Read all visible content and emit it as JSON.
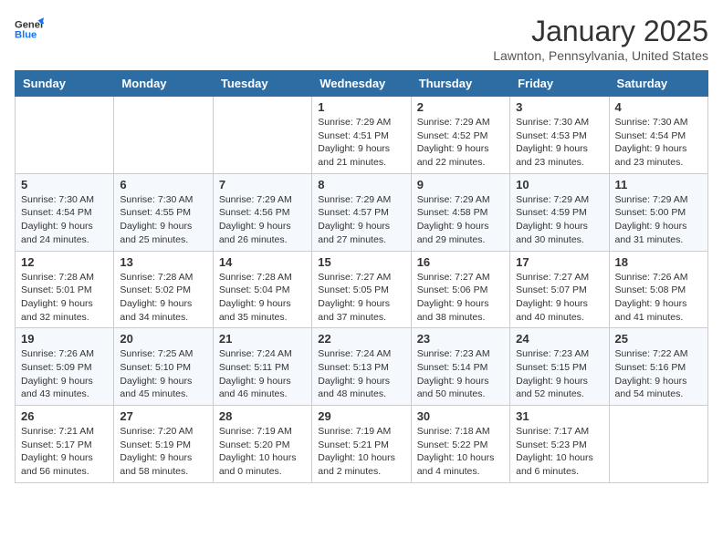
{
  "header": {
    "logo_general": "General",
    "logo_blue": "Blue",
    "title": "January 2025",
    "subtitle": "Lawnton, Pennsylvania, United States"
  },
  "days_of_week": [
    "Sunday",
    "Monday",
    "Tuesday",
    "Wednesday",
    "Thursday",
    "Friday",
    "Saturday"
  ],
  "weeks": [
    [
      {
        "day": "",
        "sunrise": "",
        "sunset": "",
        "daylight": ""
      },
      {
        "day": "",
        "sunrise": "",
        "sunset": "",
        "daylight": ""
      },
      {
        "day": "",
        "sunrise": "",
        "sunset": "",
        "daylight": ""
      },
      {
        "day": "1",
        "sunrise": "7:29 AM",
        "sunset": "4:51 PM",
        "daylight": "9 hours and 21 minutes."
      },
      {
        "day": "2",
        "sunrise": "7:29 AM",
        "sunset": "4:52 PM",
        "daylight": "9 hours and 22 minutes."
      },
      {
        "day": "3",
        "sunrise": "7:30 AM",
        "sunset": "4:53 PM",
        "daylight": "9 hours and 23 minutes."
      },
      {
        "day": "4",
        "sunrise": "7:30 AM",
        "sunset": "4:54 PM",
        "daylight": "9 hours and 23 minutes."
      }
    ],
    [
      {
        "day": "5",
        "sunrise": "7:30 AM",
        "sunset": "4:54 PM",
        "daylight": "9 hours and 24 minutes."
      },
      {
        "day": "6",
        "sunrise": "7:30 AM",
        "sunset": "4:55 PM",
        "daylight": "9 hours and 25 minutes."
      },
      {
        "day": "7",
        "sunrise": "7:29 AM",
        "sunset": "4:56 PM",
        "daylight": "9 hours and 26 minutes."
      },
      {
        "day": "8",
        "sunrise": "7:29 AM",
        "sunset": "4:57 PM",
        "daylight": "9 hours and 27 minutes."
      },
      {
        "day": "9",
        "sunrise": "7:29 AM",
        "sunset": "4:58 PM",
        "daylight": "9 hours and 29 minutes."
      },
      {
        "day": "10",
        "sunrise": "7:29 AM",
        "sunset": "4:59 PM",
        "daylight": "9 hours and 30 minutes."
      },
      {
        "day": "11",
        "sunrise": "7:29 AM",
        "sunset": "5:00 PM",
        "daylight": "9 hours and 31 minutes."
      }
    ],
    [
      {
        "day": "12",
        "sunrise": "7:28 AM",
        "sunset": "5:01 PM",
        "daylight": "9 hours and 32 minutes."
      },
      {
        "day": "13",
        "sunrise": "7:28 AM",
        "sunset": "5:02 PM",
        "daylight": "9 hours and 34 minutes."
      },
      {
        "day": "14",
        "sunrise": "7:28 AM",
        "sunset": "5:04 PM",
        "daylight": "9 hours and 35 minutes."
      },
      {
        "day": "15",
        "sunrise": "7:27 AM",
        "sunset": "5:05 PM",
        "daylight": "9 hours and 37 minutes."
      },
      {
        "day": "16",
        "sunrise": "7:27 AM",
        "sunset": "5:06 PM",
        "daylight": "9 hours and 38 minutes."
      },
      {
        "day": "17",
        "sunrise": "7:27 AM",
        "sunset": "5:07 PM",
        "daylight": "9 hours and 40 minutes."
      },
      {
        "day": "18",
        "sunrise": "7:26 AM",
        "sunset": "5:08 PM",
        "daylight": "9 hours and 41 minutes."
      }
    ],
    [
      {
        "day": "19",
        "sunrise": "7:26 AM",
        "sunset": "5:09 PM",
        "daylight": "9 hours and 43 minutes."
      },
      {
        "day": "20",
        "sunrise": "7:25 AM",
        "sunset": "5:10 PM",
        "daylight": "9 hours and 45 minutes."
      },
      {
        "day": "21",
        "sunrise": "7:24 AM",
        "sunset": "5:11 PM",
        "daylight": "9 hours and 46 minutes."
      },
      {
        "day": "22",
        "sunrise": "7:24 AM",
        "sunset": "5:13 PM",
        "daylight": "9 hours and 48 minutes."
      },
      {
        "day": "23",
        "sunrise": "7:23 AM",
        "sunset": "5:14 PM",
        "daylight": "9 hours and 50 minutes."
      },
      {
        "day": "24",
        "sunrise": "7:23 AM",
        "sunset": "5:15 PM",
        "daylight": "9 hours and 52 minutes."
      },
      {
        "day": "25",
        "sunrise": "7:22 AM",
        "sunset": "5:16 PM",
        "daylight": "9 hours and 54 minutes."
      }
    ],
    [
      {
        "day": "26",
        "sunrise": "7:21 AM",
        "sunset": "5:17 PM",
        "daylight": "9 hours and 56 minutes."
      },
      {
        "day": "27",
        "sunrise": "7:20 AM",
        "sunset": "5:19 PM",
        "daylight": "9 hours and 58 minutes."
      },
      {
        "day": "28",
        "sunrise": "7:19 AM",
        "sunset": "5:20 PM",
        "daylight": "10 hours and 0 minutes."
      },
      {
        "day": "29",
        "sunrise": "7:19 AM",
        "sunset": "5:21 PM",
        "daylight": "10 hours and 2 minutes."
      },
      {
        "day": "30",
        "sunrise": "7:18 AM",
        "sunset": "5:22 PM",
        "daylight": "10 hours and 4 minutes."
      },
      {
        "day": "31",
        "sunrise": "7:17 AM",
        "sunset": "5:23 PM",
        "daylight": "10 hours and 6 minutes."
      },
      {
        "day": "",
        "sunrise": "",
        "sunset": "",
        "daylight": ""
      }
    ]
  ]
}
